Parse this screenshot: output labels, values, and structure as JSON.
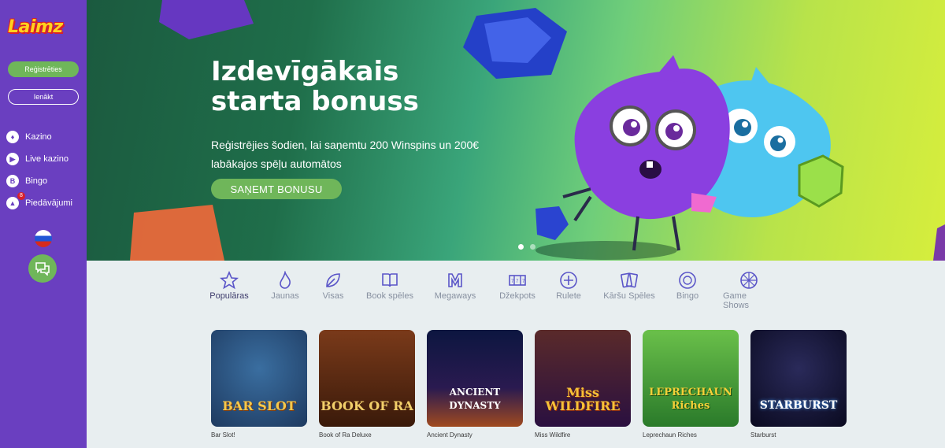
{
  "sidebar": {
    "logo": "Laimz",
    "register_label": "Reģistrēties",
    "login_label": "Ienākt",
    "items": [
      {
        "label": "Kazino",
        "icon": "casino-icon"
      },
      {
        "label": "Live kazino",
        "icon": "live-casino-icon"
      },
      {
        "label": "Bingo",
        "icon": "bingo-icon"
      },
      {
        "label": "Piedāvājumi",
        "icon": "offers-icon",
        "badge": "8"
      }
    ]
  },
  "hero": {
    "title": "Izdevīgākais starta bonuss",
    "subtitle": "Reģistrējies šodien, lai saņemtu 200 Winspins un 200€ labākajos spēļu automātos",
    "cta_label": "SAŅEMT BONUSU",
    "slides": 2,
    "active_slide": 1
  },
  "categories": [
    {
      "label": "Populāras",
      "icon": "star-icon",
      "active": true
    },
    {
      "label": "Jaunas",
      "icon": "flame-icon",
      "active": false
    },
    {
      "label": "Visas",
      "icon": "leaf-icon",
      "active": false
    },
    {
      "label": "Book spēles",
      "icon": "book-icon",
      "active": false
    },
    {
      "label": "Megaways",
      "icon": "megaways-icon",
      "active": false
    },
    {
      "label": "Džekpots",
      "icon": "jackpot-icon",
      "active": false
    },
    {
      "label": "Rulete",
      "icon": "roulette-icon",
      "active": false
    },
    {
      "label": "Kāršu Spēles",
      "icon": "cards-icon",
      "active": false
    },
    {
      "label": "Bingo",
      "icon": "bingo-ball-icon",
      "active": false
    },
    {
      "label": "Game Shows",
      "icon": "wheel-icon",
      "active": false
    }
  ],
  "games": [
    {
      "name": "Bar Slot!",
      "art_text": "BAR SLOT"
    },
    {
      "name": "Book of Ra Deluxe",
      "art_text": "BOOK OF RA"
    },
    {
      "name": "Ancient Dynasty",
      "art_text": "ANCIENT DYNASTY"
    },
    {
      "name": "Miss Wildfire",
      "art_text": "Miss WILDFIRE"
    },
    {
      "name": "Leprechaun Riches",
      "art_text": "LEPRECHAUN Riches"
    },
    {
      "name": "Starburst",
      "art_text": "STARBURST"
    }
  ],
  "colors": {
    "sidebar": "#6a3fc0",
    "accent_green": "#6fb65a",
    "page_bg": "#e8eef0",
    "category_active": "#3d3b6b",
    "category_inactive": "#8790a0"
  }
}
